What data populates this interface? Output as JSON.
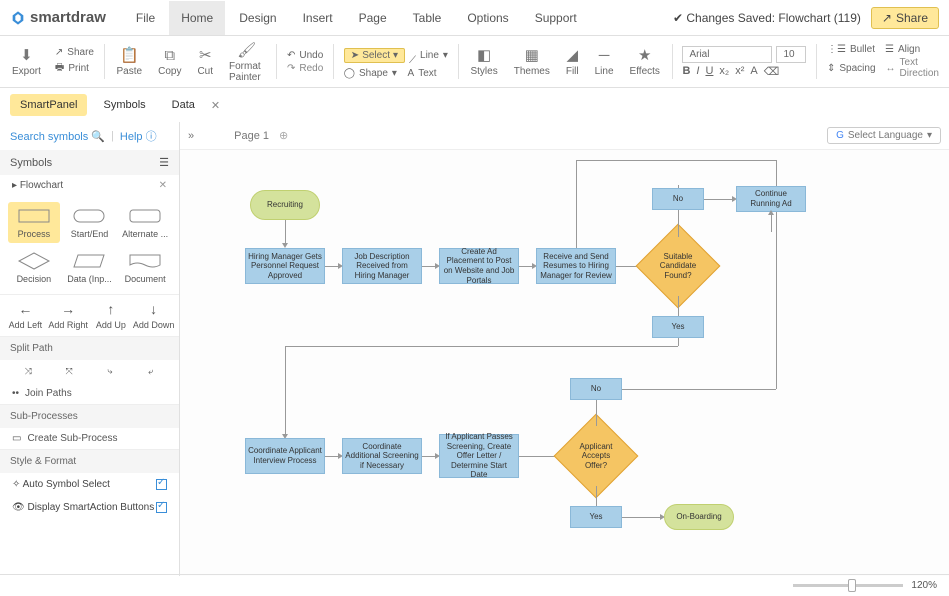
{
  "app": {
    "name": "smartdraw",
    "status": "Changes Saved: Flowchart (119)",
    "share": "Share"
  },
  "menu": [
    "File",
    "Home",
    "Design",
    "Insert",
    "Page",
    "Table",
    "Options",
    "Support"
  ],
  "ribbon": {
    "export": "Export",
    "share": "Share",
    "print": "Print",
    "paste": "Paste",
    "copy": "Copy",
    "cut": "Cut",
    "format_painter": "Format Painter",
    "undo": "Undo",
    "redo": "Redo",
    "select": "Select",
    "line": "Line",
    "shape": "Shape",
    "text": "Text",
    "styles": "Styles",
    "themes": "Themes",
    "fill": "Fill",
    "line2": "Line",
    "effects": "Effects",
    "font": "Arial",
    "font_size": "10",
    "bullet": "Bullet",
    "align": "Align",
    "spacing": "Spacing",
    "text_direction": "Text Direction"
  },
  "panel_tabs": [
    "SmartPanel",
    "Symbols",
    "Data"
  ],
  "sidebar": {
    "search": "Search symbols",
    "help": "Help",
    "symbols_title": "Symbols",
    "lib": "Flowchart",
    "shapes": [
      "Process",
      "Start/End",
      "Alternate ...",
      "Decision",
      "Data (Inp...",
      "Document"
    ],
    "add": [
      "Add Left",
      "Add Right",
      "Add Up",
      "Add Down"
    ],
    "split": "Split Path",
    "join": "Join Paths",
    "subp_title": "Sub-Processes",
    "create_sub": "Create Sub-Process",
    "style_title": "Style & Format",
    "auto_symbol": "Auto Symbol Select",
    "smartaction": "Display SmartAction Buttons"
  },
  "canvas": {
    "page": "Page 1",
    "lang": "Select Language",
    "zoom": "120%"
  },
  "nodes": {
    "n1": "Recruiting",
    "n2": "Hiring Manager Gets Personnel Request Approved",
    "n3": "Job Description Received from Hiring Manager",
    "n4": "Create Ad Placement to Post on Website and Job Portals",
    "n5": "Receive and Send Resumes to Hiring Manager for Review",
    "d1": "Suitable Candidate Found?",
    "n6": "No",
    "n7": "Continue Running Ad",
    "n8": "Yes",
    "n9": "No",
    "n10": "Coordinate Applicant Interview Process",
    "n11": "Coordinate Additional Screening if Necessary",
    "n12": "If Applicant Passes Screening, Create Offer Letter / Determine Start Date",
    "d2": "Applicant Accepts Offer?",
    "n13": "Yes",
    "n14": "On-Boarding"
  }
}
